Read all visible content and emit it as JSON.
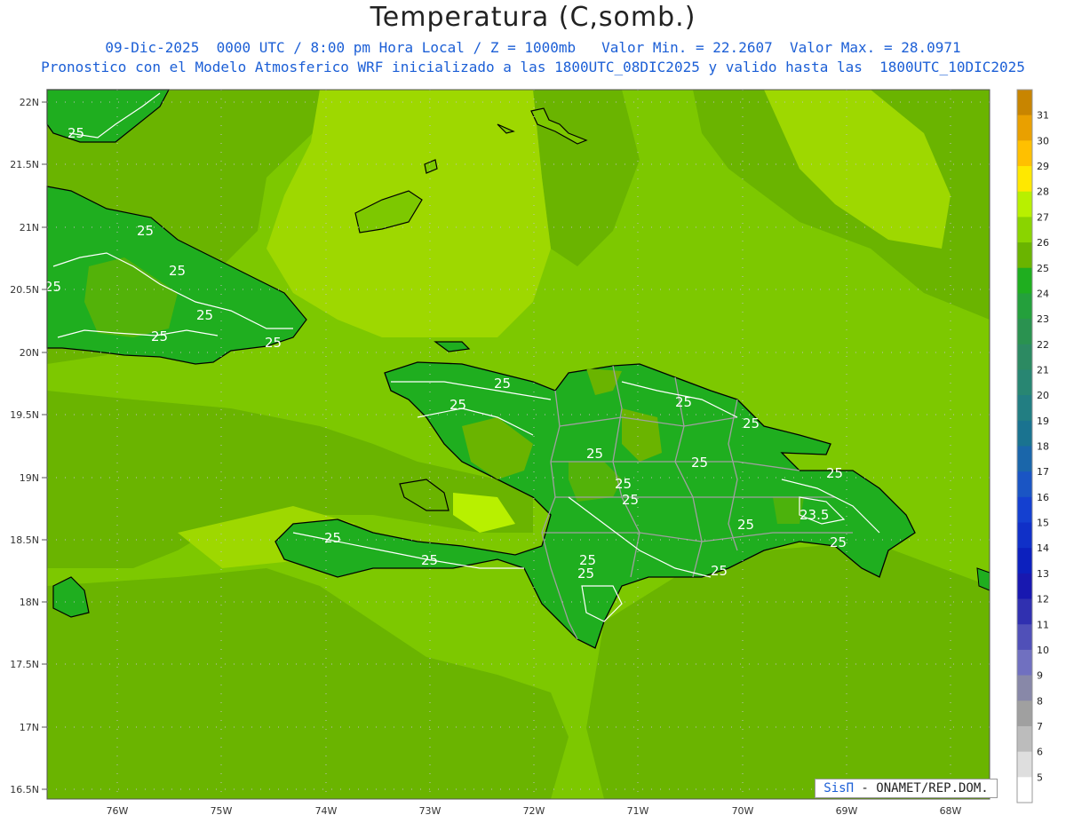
{
  "header": {
    "title": "Temperatura (C,somb.)",
    "line1": "09-Dic-2025  0000 UTC / 8:00 pm Hora Local / Z = 1000mb   Valor Min. = 22.2607  Valor Max. = 28.0971",
    "line2": "Pronostico con el Modelo Atmosferico WRF inicializado a las 1800UTC_08DIC2025 y valido hasta las  1800UTC_10DIC2025"
  },
  "lat_labels": [
    "22N",
    "21.5N",
    "21N",
    "20.5N",
    "20N",
    "19.5N",
    "19N",
    "18.5N",
    "18N",
    "17.5N",
    "17N",
    "16.5N"
  ],
  "lon_labels": [
    "76W",
    "75W",
    "74W",
    "73W",
    "72W",
    "71W",
    "70W",
    "69W",
    "68W"
  ],
  "colorbar": {
    "labels": [
      "31",
      "30",
      "29",
      "28",
      "27",
      "26",
      "25",
      "24",
      "23",
      "22",
      "21",
      "20",
      "19",
      "18",
      "17",
      "16",
      "15",
      "14",
      "13",
      "12",
      "11",
      "10",
      "9",
      "8",
      "7",
      "6",
      "5"
    ],
    "colors": [
      "#c88500",
      "#e9a000",
      "#ffc000",
      "#ffe800",
      "#b8f000",
      "#8ad400",
      "#6ab400",
      "#1fae1f",
      "#24a03c",
      "#2a9250",
      "#2c8a62",
      "#288672",
      "#227e82",
      "#1a7390",
      "#1a66aa",
      "#1a55c4",
      "#1440d0",
      "#1030c8",
      "#0c20be",
      "#1818b0",
      "#3030b0",
      "#5050b8",
      "#7070c0",
      "#8888a8",
      "#a0a0a0",
      "#bcbcbc",
      "#dedede",
      "#ffffff"
    ]
  },
  "contour_labels": [
    "25",
    "25",
    "25",
    "25",
    "25",
    "25",
    "25",
    "25",
    "25",
    "25",
    "25",
    "25",
    "25",
    "25",
    "25",
    "25",
    "25",
    "25",
    "23.5",
    "25",
    "25",
    "25",
    "25",
    "25"
  ],
  "credit": {
    "brand": "SisΠ",
    "text": " - ONAMET/REP.DOM."
  },
  "colors": {
    "sea_light": "#8ad400",
    "sea_mid": "#6ab400",
    "land": "#1fae1f",
    "title_blue": "#1c5fd6"
  }
}
